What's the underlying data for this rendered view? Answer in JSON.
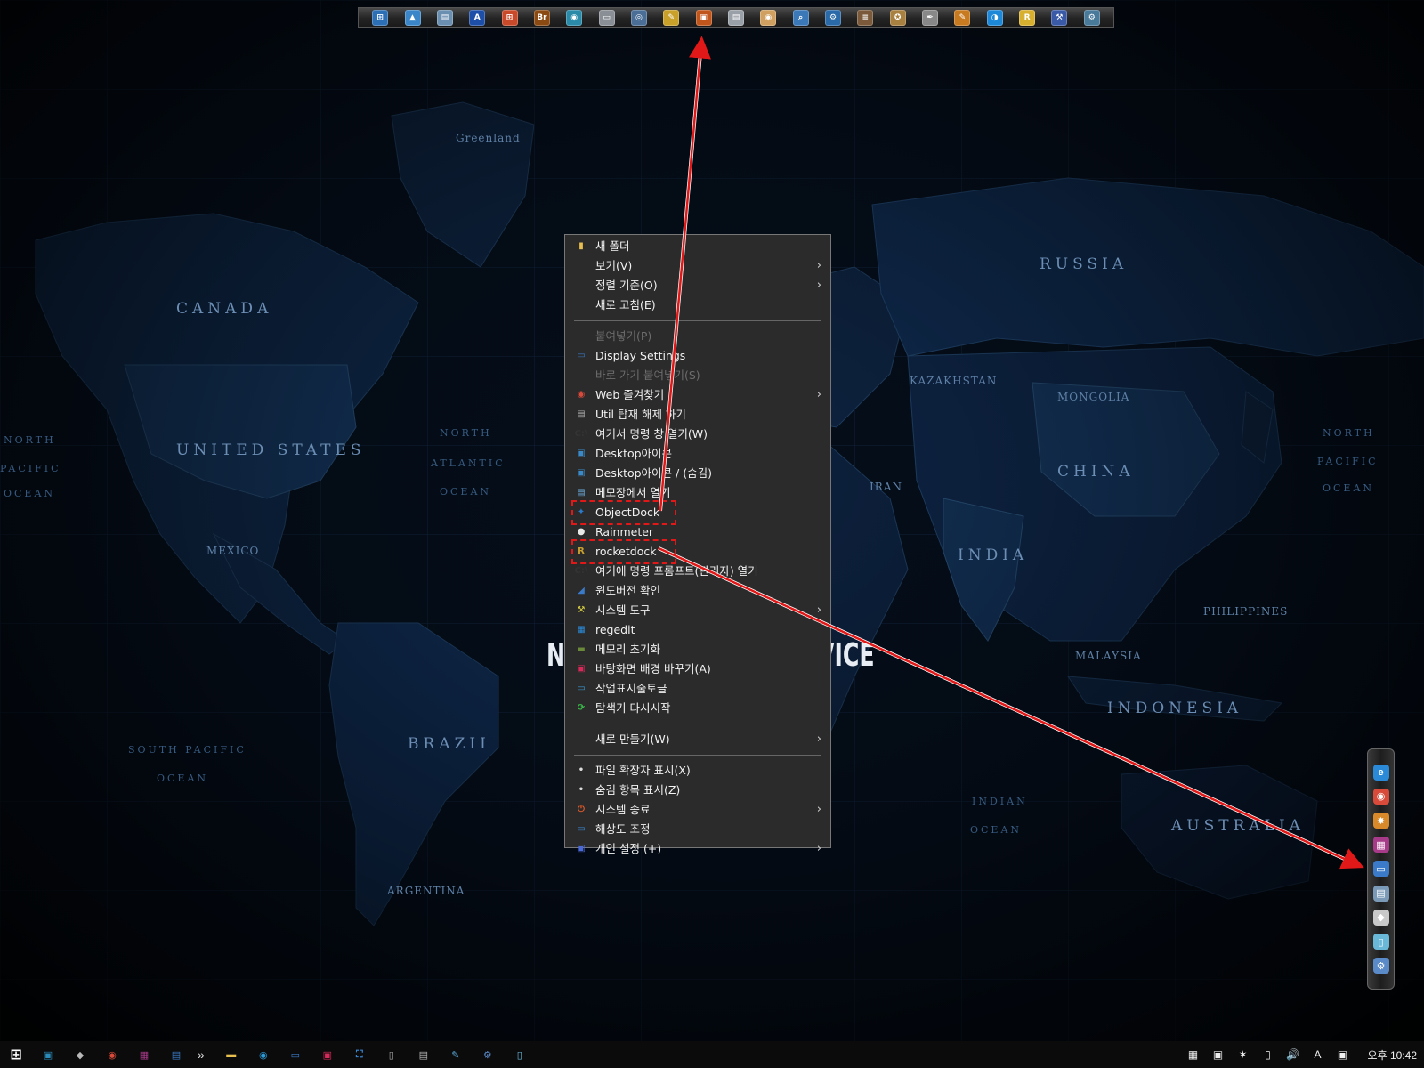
{
  "map": {
    "labels": [
      {
        "text": "Greenland",
        "kind": "small"
      },
      {
        "text": "CANADA",
        "kind": "country"
      },
      {
        "text": "UNITED STATES",
        "kind": "country"
      },
      {
        "text": "MEXICO",
        "kind": "small"
      },
      {
        "text": "RUSSIA",
        "kind": "country"
      },
      {
        "text": "KAZAKHSTAN",
        "kind": "small"
      },
      {
        "text": "MONGOLIA",
        "kind": "small"
      },
      {
        "text": "CHINA",
        "kind": "country"
      },
      {
        "text": "IRAN",
        "kind": "small"
      },
      {
        "text": "INDIA",
        "kind": "country"
      },
      {
        "text": "INDONESIA",
        "kind": "country"
      },
      {
        "text": "AUSTRALIA",
        "kind": "country"
      },
      {
        "text": "BRAZIL",
        "kind": "country"
      },
      {
        "text": "ARGENTINA",
        "kind": "small"
      },
      {
        "text": "NORTH",
        "kind": "ocean"
      },
      {
        "text": "ATLANTIC",
        "kind": "ocean"
      },
      {
        "text": "OCEAN",
        "kind": "ocean"
      },
      {
        "text": "NORTH",
        "kind": "ocean"
      },
      {
        "text": "PACIFIC",
        "kind": "ocean"
      },
      {
        "text": "OCEAN",
        "kind": "ocean"
      },
      {
        "text": "NORTH",
        "kind": "ocean"
      },
      {
        "text": "PACIFIC",
        "kind": "ocean"
      },
      {
        "text": "OCEAN",
        "kind": "ocean"
      },
      {
        "text": "SOUTH PACIFIC",
        "kind": "ocean"
      },
      {
        "text": "OCEAN",
        "kind": "ocean"
      },
      {
        "text": "INDIAN",
        "kind": "ocean"
      },
      {
        "text": "OCEAN",
        "kind": "ocean"
      },
      {
        "text": "PHILIPPINES",
        "kind": "small"
      },
      {
        "text": "MALAYSIA",
        "kind": "small"
      },
      {
        "text": "NA",
        "kind": "big"
      },
      {
        "text": "VICE",
        "kind": "big"
      }
    ]
  },
  "top_dock": {
    "icons": [
      {
        "name": "windows-icon",
        "glyph": "⊞",
        "color": "#2d6fb5"
      },
      {
        "name": "triangle-app-icon",
        "glyph": "▲",
        "color": "#3a86c8"
      },
      {
        "name": "computer-icon",
        "glyph": "▤",
        "color": "#6b8fb0"
      },
      {
        "name": "adobe-a-icon",
        "glyph": "A",
        "color": "#1d4fa8"
      },
      {
        "name": "windows-flag-icon",
        "glyph": "⊞",
        "color": "#c94a2a"
      },
      {
        "name": "bridge-icon",
        "glyph": "Br",
        "color": "#8a4a12"
      },
      {
        "name": "camera-icon",
        "glyph": "◉",
        "color": "#2a8aa8"
      },
      {
        "name": "notepad-icon",
        "glyph": "▭",
        "color": "#8a8f96"
      },
      {
        "name": "disk-icon",
        "glyph": "◎",
        "color": "#4a6e96"
      },
      {
        "name": "paint-icon",
        "glyph": "✎",
        "color": "#c8a02a"
      },
      {
        "name": "presentation-icon",
        "glyph": "▣",
        "color": "#c0561c"
      },
      {
        "name": "document-icon",
        "glyph": "▤",
        "color": "#9aa0a8"
      },
      {
        "name": "cd-icon",
        "glyph": "◉",
        "color": "#d0a060"
      },
      {
        "name": "search-tool-icon",
        "glyph": "⌕",
        "color": "#3a78b8"
      },
      {
        "name": "gear-icon",
        "glyph": "⚙",
        "color": "#2a6aa8"
      },
      {
        "name": "bar-app-icon",
        "glyph": "≡",
        "color": "#7a5a3a"
      },
      {
        "name": "badge-icon",
        "glyph": "✪",
        "color": "#a88040"
      },
      {
        "name": "pen-icon",
        "glyph": "✒",
        "color": "#888"
      },
      {
        "name": "brush-icon",
        "glyph": "✎",
        "color": "#c87a20"
      },
      {
        "name": "blue-circle-icon",
        "glyph": "◑",
        "color": "#1e88d8"
      },
      {
        "name": "r-app-icon",
        "glyph": "R",
        "color": "#d8b030"
      },
      {
        "name": "tools-icon",
        "glyph": "⚒",
        "color": "#3a5aa8"
      },
      {
        "name": "settings-icon",
        "glyph": "⚙",
        "color": "#4a7a9a"
      }
    ]
  },
  "context_menu": {
    "items": [
      {
        "type": "item",
        "label": "새 폴더",
        "icon": "folder-icon",
        "glyph": "▮",
        "icon_color": "#e8c050"
      },
      {
        "type": "item",
        "label": "보기(V)",
        "submenu": true
      },
      {
        "type": "item",
        "label": "정렬 기준(O)",
        "submenu": true
      },
      {
        "type": "item",
        "label": "새로 고침(E)"
      },
      {
        "type": "separator"
      },
      {
        "type": "item",
        "label": "붙여넣기(P)",
        "disabled": true
      },
      {
        "type": "item",
        "label": "Display Settings",
        "icon": "monitor-icon",
        "glyph": "▭",
        "icon_color": "#3a7ac8"
      },
      {
        "type": "item",
        "label": "바로 가기 붙여넣기(S)",
        "disabled": true
      },
      {
        "type": "item",
        "label": "Web 즐겨찾기",
        "icon": "chrome-icon",
        "glyph": "◉",
        "icon_color": "#d84a3a",
        "submenu": true
      },
      {
        "type": "item",
        "label": "Util 탑재 해제 하기",
        "icon": "printer-icon",
        "glyph": "▤",
        "icon_color": "#b0b0b0"
      },
      {
        "type": "item",
        "label": "여기서 명령 창 열기(W)",
        "icon": "cmd-icon",
        "glyph": "C:\\",
        "icon_color": "#333"
      },
      {
        "type": "item",
        "label": "Desktop아이콘",
        "icon": "desktop-icon",
        "glyph": "▣",
        "icon_color": "#3a8ac8"
      },
      {
        "type": "item",
        "label": "Desktop아이콘 / (숨김)",
        "icon": "desktop-hidden-icon",
        "glyph": "▣",
        "icon_color": "#3a8ac8"
      },
      {
        "type": "item",
        "label": "메모장에서 열기",
        "icon": "notepad-icon",
        "glyph": "▤",
        "icon_color": "#6aa8d8"
      },
      {
        "type": "item",
        "label": "ObjectDock",
        "icon": "objectdock-icon",
        "glyph": "✦",
        "icon_color": "#2a7ac8",
        "highlight": true
      },
      {
        "type": "item",
        "label": "Rainmeter",
        "icon": "droplet-icon",
        "glyph": "●",
        "icon_color": "#e8e8e8"
      },
      {
        "type": "item",
        "label": "rocketdock",
        "icon": "rocketdock-icon",
        "glyph": "R",
        "icon_color": "#c8a030",
        "highlight": true
      },
      {
        "type": "item",
        "label": "여기에 명령 프롬프트(관리자) 열기",
        "icon": "cmd-admin-icon",
        "glyph": "C:\\",
        "icon_color": "#333"
      },
      {
        "type": "item",
        "label": "윈도버전 확인",
        "icon": "winver-icon",
        "glyph": "◢",
        "icon_color": "#3a7ac8"
      },
      {
        "type": "item",
        "label": "시스템 도구",
        "icon": "system-tools-icon",
        "glyph": "⚒",
        "icon_color": "#d8d040",
        "submenu": true
      },
      {
        "type": "item",
        "label": "regedit",
        "icon": "regedit-icon",
        "glyph": "▦",
        "icon_color": "#2a8ad8"
      },
      {
        "type": "item",
        "label": "메모리 초기화",
        "icon": "memory-icon",
        "glyph": "▬",
        "icon_color": "#6a8a3a"
      },
      {
        "type": "item",
        "label": "바탕화면 배경 바꾸기(A)",
        "icon": "wallpaper-icon",
        "glyph": "▣",
        "icon_color": "#d82a5a"
      },
      {
        "type": "item",
        "label": "작업표시줄토글",
        "icon": "taskbar-toggle-icon",
        "glyph": "▭",
        "icon_color": "#3a9ad8"
      },
      {
        "type": "item",
        "label": "탐색기 다시시작",
        "icon": "refresh-icon",
        "glyph": "⟳",
        "icon_color": "#3ab84a"
      },
      {
        "type": "separator"
      },
      {
        "type": "item",
        "label": "새로 만들기(W)",
        "submenu": true
      },
      {
        "type": "separator"
      },
      {
        "type": "item",
        "label": "파일 확장자 표시(X)",
        "bullet": true
      },
      {
        "type": "item",
        "label": "숨김 항목 표시(Z)",
        "bullet": true
      },
      {
        "type": "item",
        "label": "시스템 종료",
        "icon": "power-icon",
        "glyph": "⏻",
        "icon_color": "#e05a2a",
        "submenu": true
      },
      {
        "type": "item",
        "label": "해상도 조정",
        "icon": "resolution-icon",
        "glyph": "▭",
        "icon_color": "#3a8ad8"
      },
      {
        "type": "item",
        "label": "개인 설정 (+)",
        "icon": "personalize-icon",
        "glyph": "▣",
        "icon_color": "#4a6ad8",
        "submenu": true
      }
    ]
  },
  "right_dock": {
    "icons": [
      {
        "name": "ie-icon",
        "glyph": "e",
        "color": "#2a8ad8"
      },
      {
        "name": "chrome-icon",
        "glyph": "◉",
        "color": "#d84a3a"
      },
      {
        "name": "compass-icon",
        "glyph": "✸",
        "color": "#d88a2a"
      },
      {
        "name": "grid-app-icon",
        "glyph": "▦",
        "color": "#a83a8a"
      },
      {
        "name": "window-icon",
        "glyph": "▭",
        "color": "#3a7ac8"
      },
      {
        "name": "computer-icon",
        "glyph": "▤",
        "color": "#7a9ab8"
      },
      {
        "name": "diamond-icon",
        "glyph": "◆",
        "color": "#c8c8c8"
      },
      {
        "name": "file-icon",
        "glyph": "▯",
        "color": "#6ab8d8"
      },
      {
        "name": "network-icon",
        "glyph": "⚙",
        "color": "#5a8ac8"
      }
    ]
  },
  "taskbar": {
    "start_icon": "windows-start-icon",
    "overflow_glyph": "»",
    "pinned": [
      {
        "name": "app-icon-1",
        "glyph": "▣",
        "color": "#2a8ab8"
      },
      {
        "name": "app-icon-2",
        "glyph": "◆",
        "color": "#b8b8b8"
      },
      {
        "name": "chrome-icon",
        "glyph": "◉",
        "color": "#d84a3a"
      },
      {
        "name": "grid-app-icon",
        "glyph": "▦",
        "color": "#a83a8a"
      },
      {
        "name": "computer-icon",
        "glyph": "▤",
        "color": "#3a7ac8"
      }
    ],
    "apps": [
      {
        "name": "folder-icon",
        "glyph": "▬",
        "color": "#e8c050"
      },
      {
        "name": "camera-icon",
        "glyph": "◉",
        "color": "#2a9ad8"
      },
      {
        "name": "window-icon",
        "glyph": "▭",
        "color": "#3a7ac8"
      },
      {
        "name": "wallpaper-icon",
        "glyph": "▣",
        "color": "#d82a5a"
      },
      {
        "name": "fullscreen-icon",
        "glyph": "⛶",
        "color": "#3a8ad8"
      },
      {
        "name": "usb-icon",
        "glyph": "▯",
        "color": "#a8a8a8"
      },
      {
        "name": "printer-icon",
        "glyph": "▤",
        "color": "#b8b8b8"
      },
      {
        "name": "tool-icon",
        "glyph": "✎",
        "color": "#5aa8d8"
      },
      {
        "name": "network-icon",
        "glyph": "⚙",
        "color": "#5a8ac8"
      },
      {
        "name": "notepad-icon",
        "glyph": "▯",
        "color": "#6ab8d8"
      }
    ],
    "tray": [
      {
        "name": "network-icon",
        "glyph": "▦"
      },
      {
        "name": "color-icon",
        "glyph": "▣"
      },
      {
        "name": "adobe-icon",
        "glyph": "✶"
      },
      {
        "name": "battery-icon",
        "glyph": "▯"
      },
      {
        "name": "speaker-icon",
        "glyph": "🔊"
      },
      {
        "name": "ime-icon",
        "glyph": "A"
      },
      {
        "name": "tray-app-icon",
        "glyph": "▣"
      }
    ],
    "clock": "오후 10:42"
  },
  "colors": {
    "menu_bg": "#2b2b2b",
    "highlight_red": "#e01818",
    "arrow_red": "#e01818"
  }
}
